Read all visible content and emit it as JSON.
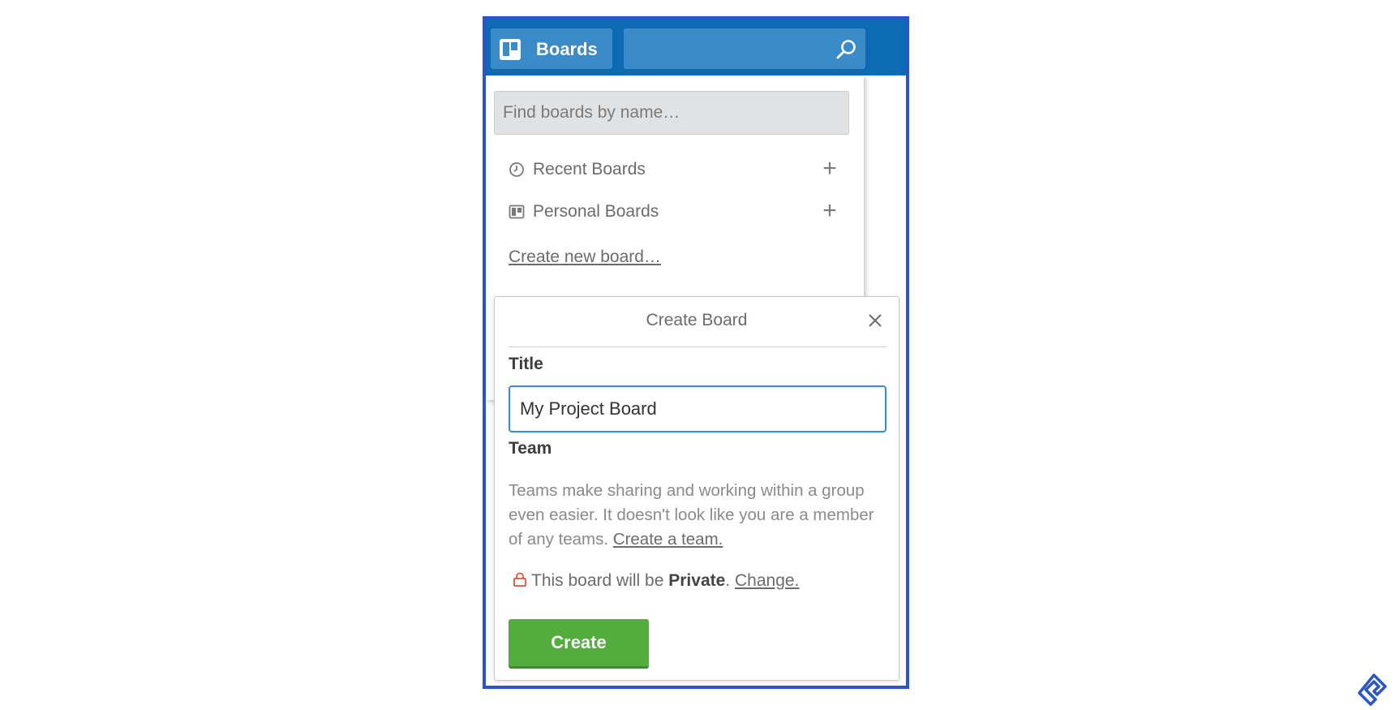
{
  "header": {
    "boards_label": "Boards",
    "search_value": ""
  },
  "dropdown": {
    "find_placeholder": "Find boards by name…",
    "items": [
      {
        "label": "Recent Boards",
        "icon": "clock-icon",
        "action": "+"
      },
      {
        "label": "Personal Boards",
        "icon": "board-icon",
        "action": "+"
      }
    ],
    "create_link": "Create new board…"
  },
  "popover": {
    "title": "Create Board",
    "title_field_label": "Title",
    "title_value": "My Project Board",
    "team_label": "Team",
    "team_text": "Teams make sharing and working within a group even easier. It doesn't look like you are a member of any teams.",
    "team_link": "Create a team.",
    "privacy_prefix": "This board will be",
    "privacy_value": "Private",
    "privacy_suffix": ".",
    "privacy_link": "Change.",
    "create_button": "Create"
  },
  "colors": {
    "header_bg": "#0d6bb3",
    "frame_border": "#2a55c9",
    "create_button": "#52ad3c",
    "lock_icon": "#e2533b"
  }
}
